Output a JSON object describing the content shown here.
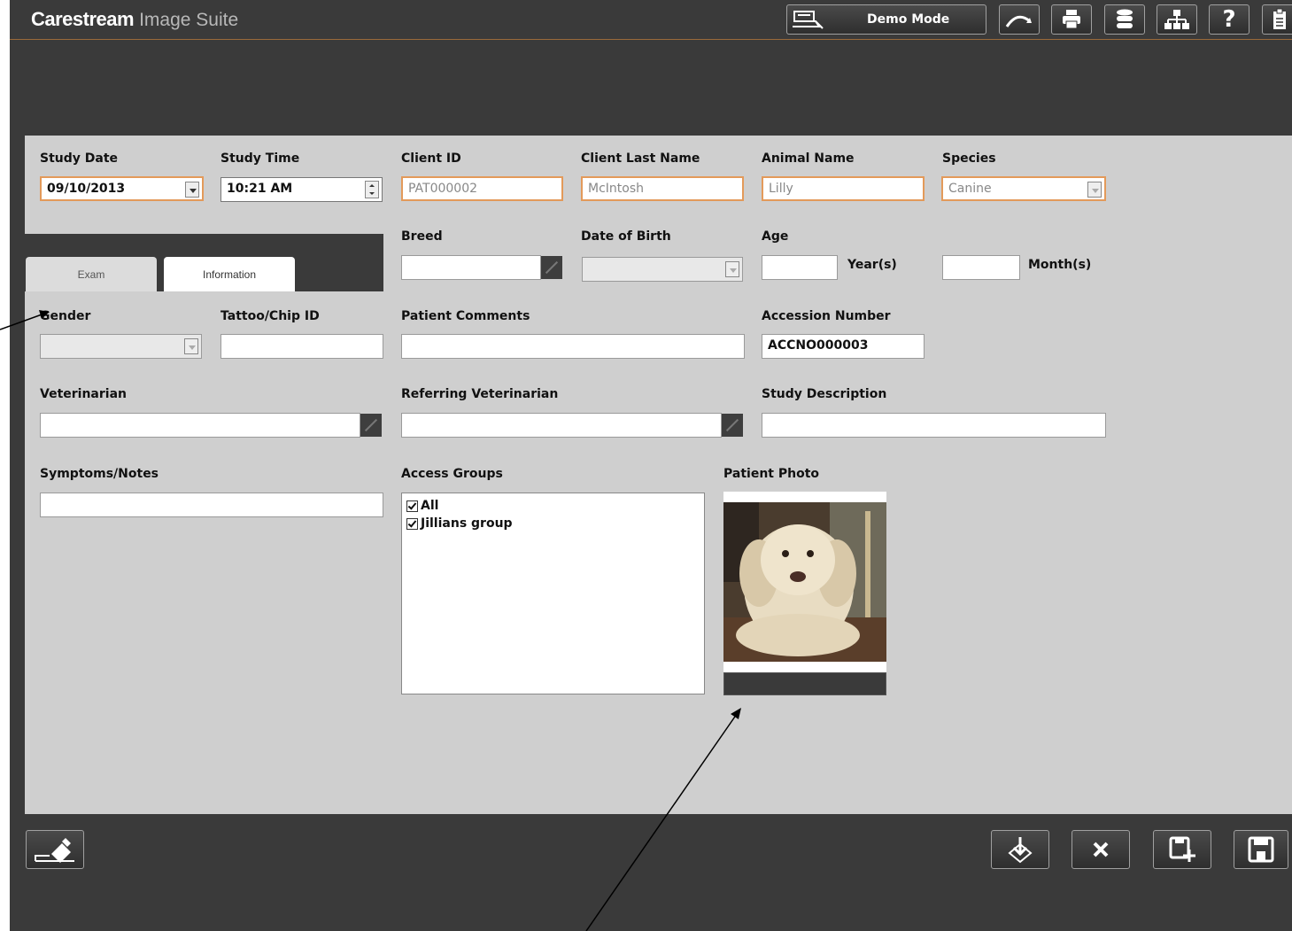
{
  "app": {
    "brand": "Carestream",
    "suite": "Image Suite",
    "demo_mode": "Demo Mode"
  },
  "toolbar_icons": [
    "monitor-icon",
    "curve-icon",
    "printer-icon",
    "database-icon",
    "network-icon",
    "help-icon",
    "clipboard-icon"
  ],
  "form": {
    "study_date_label": "Study Date",
    "study_date_value": "09/10/2013",
    "study_time_label": "Study Time",
    "study_time_value": "10:21 AM",
    "client_id_label": "Client ID",
    "client_id_value": "PAT000002",
    "client_last_name_label": "Client Last Name",
    "client_last_name_value": "McIntosh",
    "animal_name_label": "Animal Name",
    "animal_name_value": "Lilly",
    "species_label": "Species",
    "species_value": "Canine",
    "breed_label": "Breed",
    "dob_label": "Date of Birth",
    "age_label": "Age",
    "years_label": "Year(s)",
    "months_label": "Month(s)",
    "gender_label": "Gender",
    "tattoo_label": "Tattoo/Chip ID",
    "patient_comments_label": "Patient Comments",
    "accession_label": "Accession Number",
    "accession_value": "ACCNO000003",
    "veterinarian_label": "Veterinarian",
    "ref_vet_label": "Referring Veterinarian",
    "study_desc_label": "Study Description",
    "symptoms_label": "Symptoms/Notes",
    "access_groups_label": "Access Groups",
    "access_groups": [
      "All",
      "Jillians group"
    ],
    "patient_photo_label": "Patient Photo"
  },
  "tabs": {
    "exam": "Exam",
    "information": "Information"
  },
  "colors": {
    "accent_orange": "#e39a5a",
    "panel_bg": "#cfcfcf",
    "chrome_bg": "#3a3a3a"
  }
}
